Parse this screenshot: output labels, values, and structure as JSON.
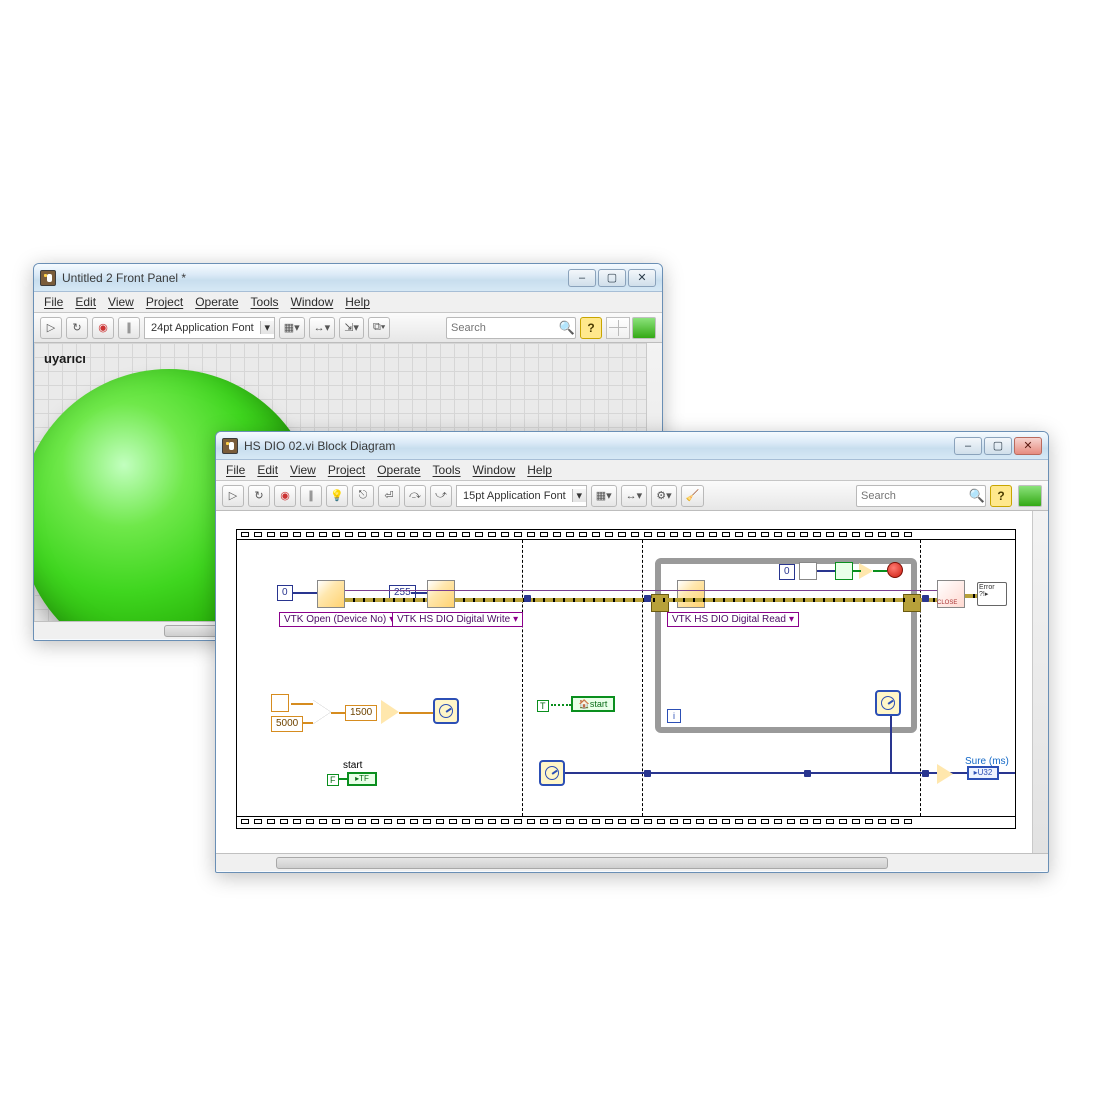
{
  "front_panel": {
    "title": "Untitled 2 Front Panel *",
    "menus": [
      "File",
      "Edit",
      "View",
      "Project",
      "Operate",
      "Tools",
      "Window",
      "Help"
    ],
    "font_selector": "24pt Application Font",
    "search_ph": "Search",
    "indicator_label": "uyarıcı"
  },
  "block_diagram": {
    "title": "HS DIO 02.vi Block Diagram",
    "menus": [
      "File",
      "Edit",
      "View",
      "Project",
      "Operate",
      "Tools",
      "Window",
      "Help"
    ],
    "font_selector": "15pt Application Font",
    "search_ph": "Search",
    "consts": {
      "zero": "0",
      "twofiftyfive": "255",
      "zero2": "0",
      "five_k": "5000",
      "onefive_k": "1500"
    },
    "poly_labels": {
      "open": "VTK Open (Device No)",
      "write": "VTK HS DIO Digital Write",
      "read": "VTK HS DIO Digital Read"
    },
    "labels": {
      "start": "start",
      "localstart": "start",
      "sure": "Sure (ms)",
      "u32": "U32",
      "tf": "TF",
      "T": "T",
      "F": "F",
      "i": "i",
      "close": "CLOSE",
      "error": "Error"
    }
  }
}
